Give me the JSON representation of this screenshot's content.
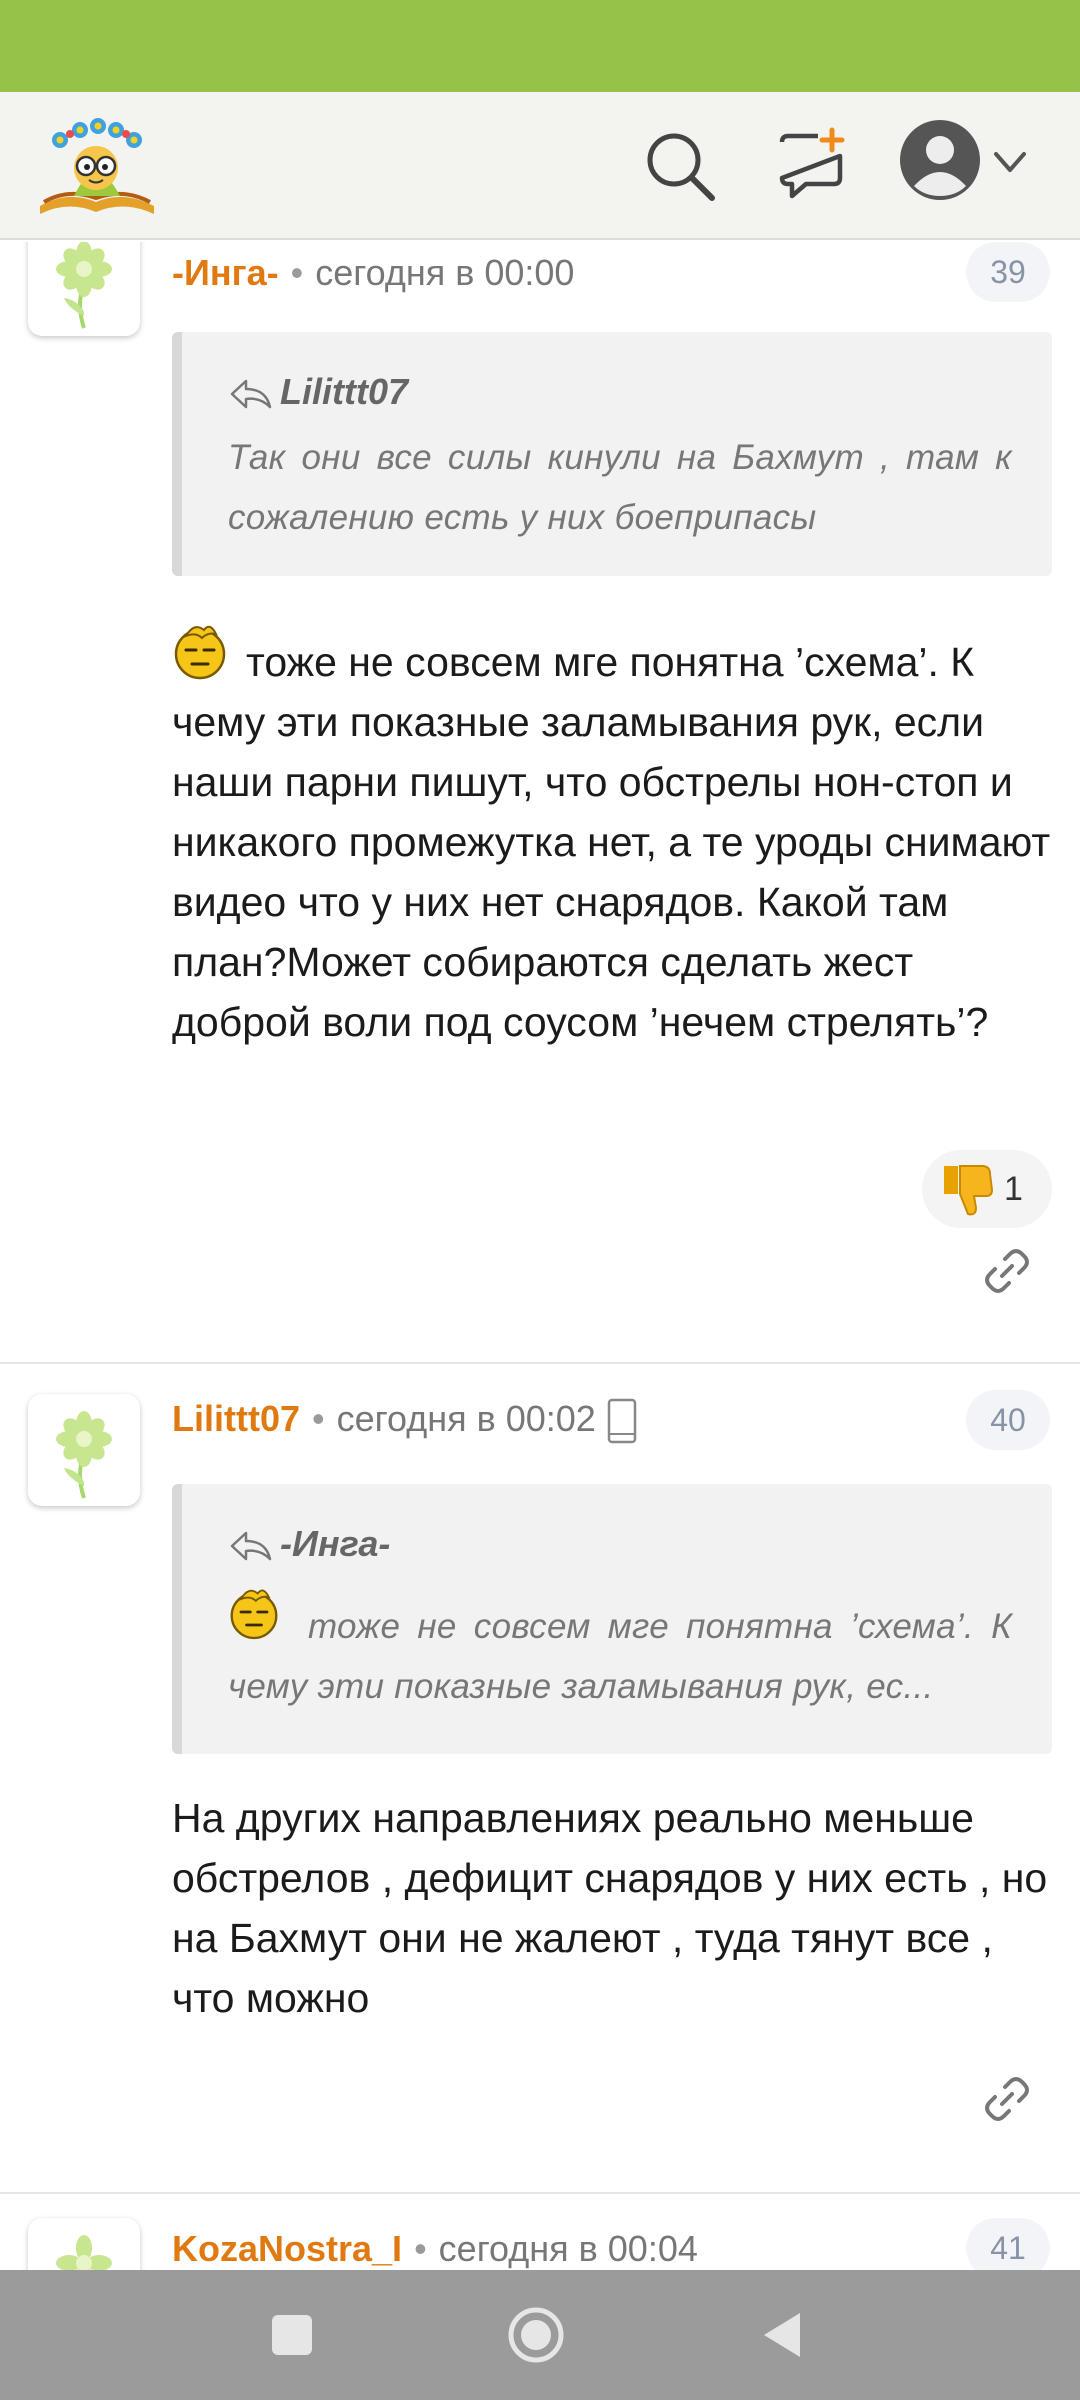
{
  "header": {
    "logo_icon": "daisy-book-logo",
    "search_icon": "search-icon",
    "new_post_icon": "add-comment-icon",
    "profile_icon": "user-avatar-icon"
  },
  "comments": [
    {
      "author": "-Инга-",
      "time": "сегодня в 00:00",
      "number": "39",
      "quote_author": "Lilittt07",
      "quote_text": "Так они все силы кинули на Бахмут , там к сожалению есть у них боеприпасы",
      "text": "тоже не совсем мге понятна ’схема’. К чему эти показные заламывания рук, если наши парни пишут, что обстрелы нон-стоп и никакого промежутка нет, а те уроды снимают видео что у них нет снарядов. Какой там план?Может собираются сделать жест доброй воли под соусом ’нечем стрелять’?",
      "reaction_icon": "thumbs-down-icon",
      "reaction_count": "1"
    },
    {
      "author": "Lilittt07",
      "time": "сегодня в 00:02",
      "device_icon": "mobile-phone-icon",
      "number": "40",
      "quote_author": "-Инга-",
      "quote_text": "тоже не совсем мге понятна ’схема’. К чему эти показные заламывания рук, ес...",
      "text": "На других направлениях реально меньше обстрелов , дефицит снарядов у них есть , но на Бахмут они не жалеют , туда тянут все , что можно"
    },
    {
      "author": "KozaNostra_I",
      "time": "сегодня в 00:04",
      "number": "41"
    }
  ],
  "colors": {
    "status_bar": "#97c24a",
    "author": "#e07a10",
    "nav_bar": "#9b9b9b"
  }
}
